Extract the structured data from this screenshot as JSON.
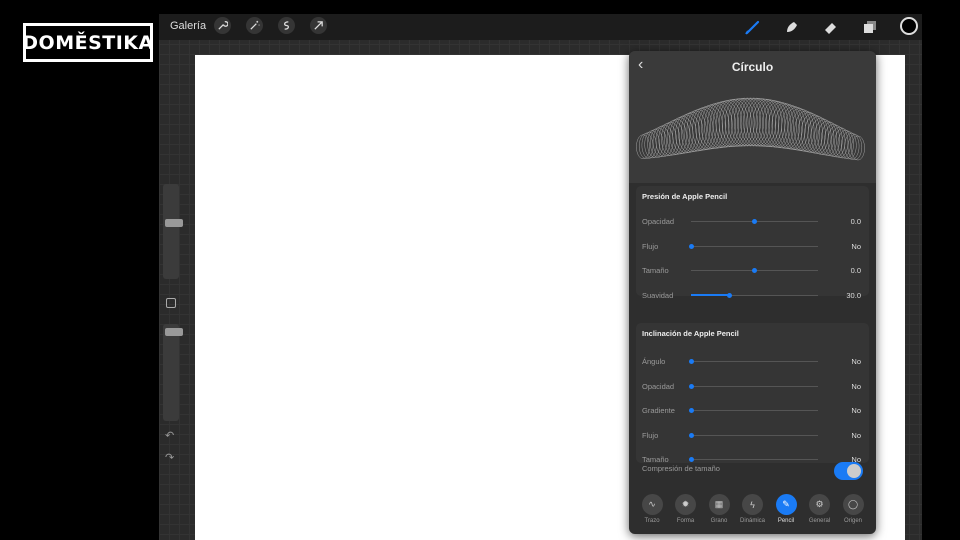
{
  "logo": {
    "text": "DOMESTIKA"
  },
  "topbar": {
    "gallery_label": "Galería",
    "left_tools": [
      {
        "icon": "wrench-icon"
      },
      {
        "icon": "magic-wand-icon"
      },
      {
        "icon": "selection-icon"
      },
      {
        "icon": "transform-arrow-icon"
      }
    ],
    "right_tools": [
      {
        "icon": "brush-icon",
        "active": true
      },
      {
        "icon": "smudge-icon"
      },
      {
        "icon": "eraser-icon"
      },
      {
        "icon": "layers-icon"
      }
    ],
    "current_color": "#000000"
  },
  "sidebar": {
    "brush_size_level": 0.6,
    "opacity_level": 0.04,
    "undo_icon": "undo-icon",
    "redo_icon": "redo-icon"
  },
  "panel": {
    "title": "Círculo",
    "back_icon": "chevron-left-icon",
    "pressure_section": {
      "title": "Presión de Apple Pencil",
      "rows": [
        {
          "label": "Opacidad",
          "value": "0.0",
          "level": 0.5,
          "fill": false
        },
        {
          "label": "Flujo",
          "value": "No",
          "level": 0.0,
          "fill": false
        },
        {
          "label": "Tamaño",
          "value": "0.0",
          "level": 0.5,
          "fill": false
        },
        {
          "label": "Suavidad",
          "value": "30.0",
          "level": 0.3,
          "fill": true
        }
      ]
    },
    "tilt_section": {
      "title": "Inclinación de Apple Pencil",
      "rows": [
        {
          "label": "Ángulo",
          "value": "No",
          "level": 0.0,
          "fill": false
        },
        {
          "label": "Opacidad",
          "value": "No",
          "level": 0.0,
          "fill": false
        },
        {
          "label": "Gradiente",
          "value": "No",
          "level": 0.0,
          "fill": false
        },
        {
          "label": "Flujo",
          "value": "No",
          "level": 0.0,
          "fill": false
        },
        {
          "label": "Tamaño",
          "value": "No",
          "level": 0.0,
          "fill": false
        }
      ]
    },
    "size_compression": {
      "label": "Compresión de tamaño",
      "enabled": true
    },
    "tabs": [
      {
        "label": "Trazo",
        "icon": "stroke-icon",
        "active": false
      },
      {
        "label": "Forma",
        "icon": "shape-icon",
        "active": false
      },
      {
        "label": "Grano",
        "icon": "grain-icon",
        "active": false
      },
      {
        "label": "Dinámica",
        "icon": "dynamics-icon",
        "active": false
      },
      {
        "label": "Pencil",
        "icon": "pencil-icon",
        "active": true
      },
      {
        "label": "General",
        "icon": "general-icon",
        "active": false
      },
      {
        "label": "Origen",
        "icon": "source-icon",
        "active": false
      }
    ]
  },
  "colors": {
    "accent": "#1a7bf5",
    "panel": "#2e2e2e",
    "canvas": "#ffffff"
  }
}
